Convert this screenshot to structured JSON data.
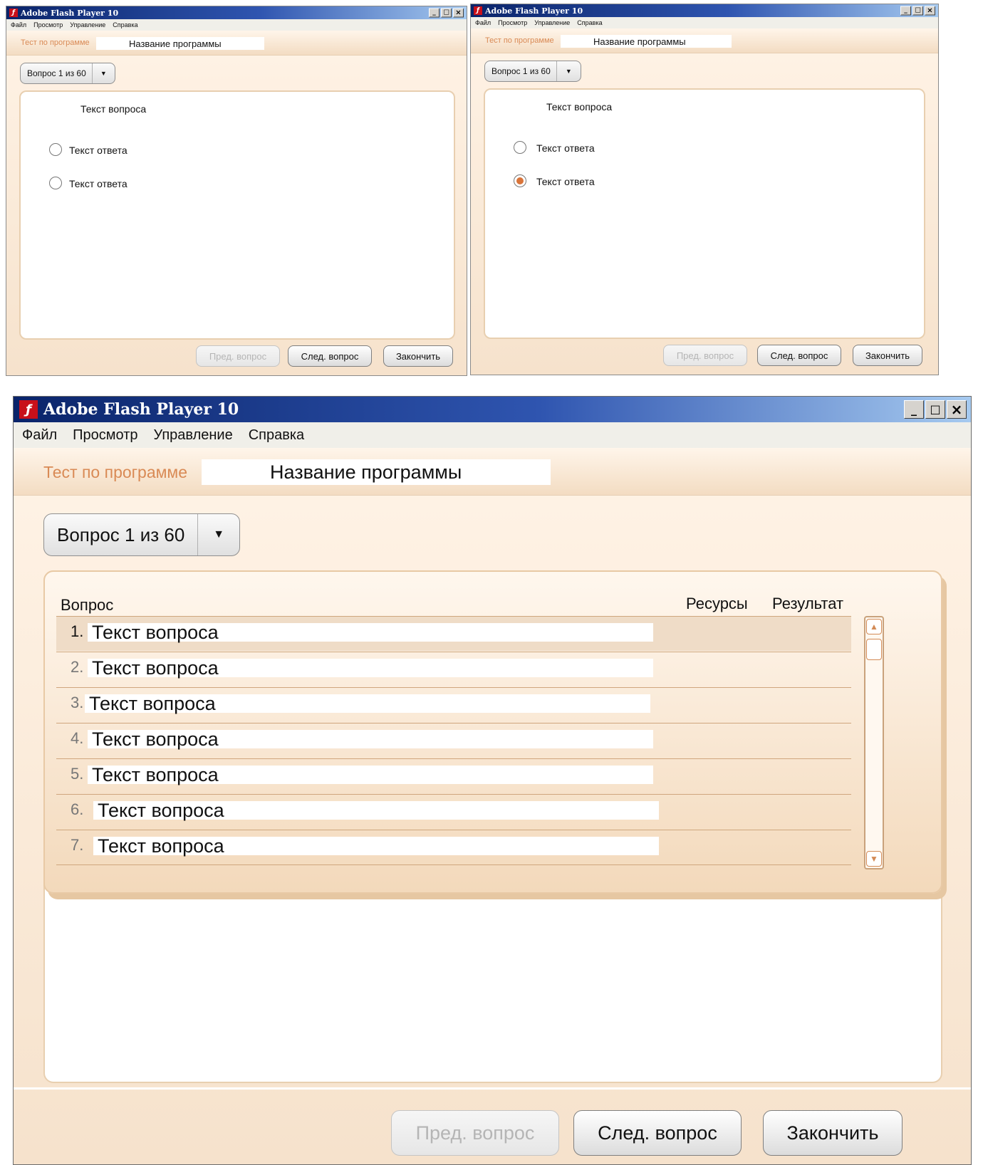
{
  "app": {
    "title": "Adobe Flash Player 10",
    "menu": [
      "Файл",
      "Просмотр",
      "Управление",
      "Справка"
    ],
    "window_buttons": [
      "_",
      "□",
      "×"
    ]
  },
  "colors": {
    "titlebar_start": "#0a246a",
    "titlebar_end": "#a6caf0",
    "accent_orange": "#d98a55",
    "background_beige": "#f4e6d6",
    "radio_selected": "#d9743a"
  },
  "icons": {
    "logo": "flash-logo-icon",
    "dropdown": "chevron-down-icon",
    "minimize": "minimize-icon",
    "maximize": "maximize-icon",
    "close": "close-icon",
    "scroll_up": "scroll-up-icon",
    "scroll_down": "scroll-down-icon"
  },
  "test": {
    "label": "Тест по программе",
    "program_name": "Название программы",
    "question_selector": "Вопрос 1 из 60"
  },
  "small_left": {
    "question_text": "Текст вопроса",
    "answers": [
      {
        "text": "Текст ответа",
        "selected": false
      },
      {
        "text": "Текст ответа",
        "selected": false
      }
    ]
  },
  "small_right": {
    "question_text": "Текст вопроса",
    "answers": [
      {
        "text": "Текст ответа",
        "selected": false
      },
      {
        "text": "Текст ответа",
        "selected": true
      }
    ]
  },
  "buttons": {
    "prev": "Пред. вопрос",
    "next": "След. вопрос",
    "finish": "Закончить"
  },
  "question_list": {
    "columns": [
      "Вопрос",
      "Ресурсы",
      "Результат"
    ],
    "rows": [
      {
        "num": "1.",
        "text": "Текст вопроса",
        "selected": true
      },
      {
        "num": "2.",
        "text": "Текст вопроса",
        "selected": false
      },
      {
        "num": "3.",
        "text": "Текст вопроса",
        "selected": false
      },
      {
        "num": "4.",
        "text": "Текст вопроса",
        "selected": false
      },
      {
        "num": "5.",
        "text": "Текст вопроса",
        "selected": false
      },
      {
        "num": "6.",
        "text": "Текст вопроса",
        "selected": false
      },
      {
        "num": "7.",
        "text": "Текст вопроса",
        "selected": false
      }
    ]
  }
}
